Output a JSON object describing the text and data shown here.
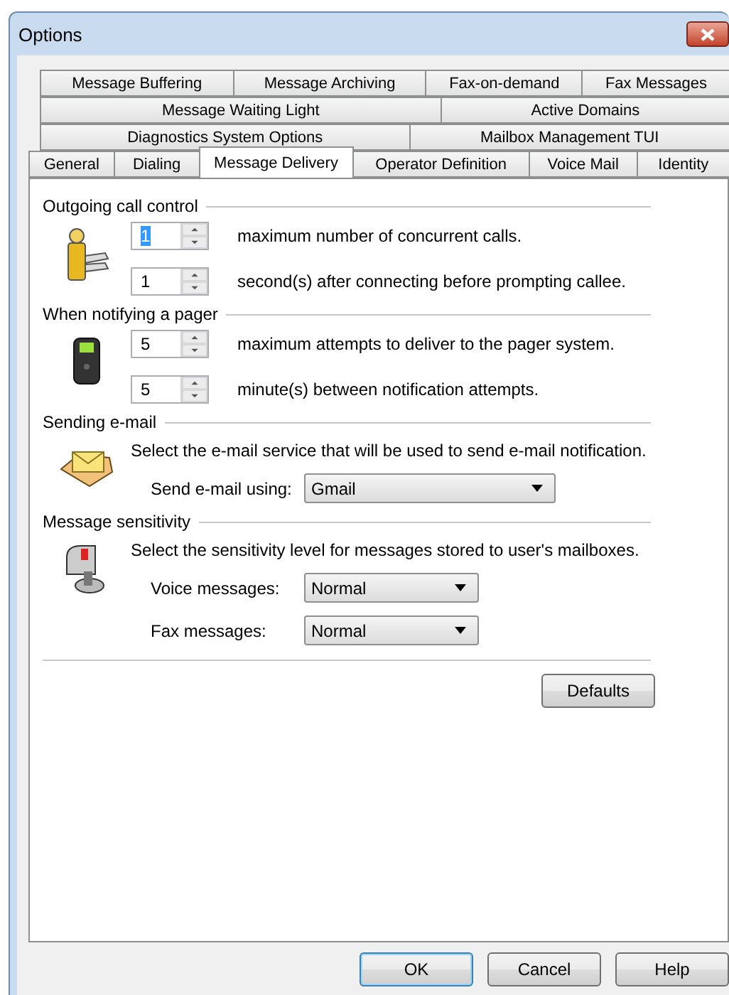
{
  "window": {
    "title": "Options"
  },
  "tab_rows": [
    [
      {
        "label": "Message Buffering",
        "selected": false
      },
      {
        "label": "Message Archiving",
        "selected": false
      },
      {
        "label": "Fax-on-demand",
        "selected": false
      },
      {
        "label": "Fax Messages",
        "selected": false
      }
    ],
    [
      {
        "label": "Message Waiting Light",
        "selected": false
      },
      {
        "label": "Active Domains",
        "selected": false
      }
    ],
    [
      {
        "label": "Diagnostics System Options",
        "selected": false
      },
      {
        "label": "Mailbox Management TUI",
        "selected": false
      }
    ],
    [
      {
        "label": "General",
        "selected": false
      },
      {
        "label": "Dialing",
        "selected": false
      },
      {
        "label": "Message Delivery",
        "selected": true
      },
      {
        "label": "Operator Definition",
        "selected": false
      },
      {
        "label": "Voice Mail",
        "selected": false
      },
      {
        "label": "Identity",
        "selected": false
      }
    ]
  ],
  "sections": [
    {
      "kind": "spinners",
      "title": "Outgoing call control",
      "rows": [
        {
          "value": "1",
          "highlighted": true,
          "label": "maximum number of concurrent calls."
        },
        {
          "value": "1",
          "highlighted": false,
          "label": "second(s) after connecting before prompting callee."
        }
      ]
    },
    {
      "kind": "spinners",
      "title": "When notifying a pager",
      "rows": [
        {
          "value": "5",
          "highlighted": false,
          "label": "maximum attempts to deliver to the pager system."
        },
        {
          "value": "5",
          "highlighted": false,
          "label": "minute(s) between notification attempts."
        }
      ]
    },
    {
      "kind": "selects",
      "title": "Sending e-mail",
      "description": "Select the e-mail service that will be used to send e-mail notification.",
      "rows": [
        {
          "label": "Send e-mail using:",
          "value": "Gmail"
        }
      ]
    },
    {
      "kind": "selects",
      "title": "Message sensitivity",
      "description": "Select the sensitivity level for messages stored to user's mailboxes.",
      "rows": [
        {
          "label": "Voice messages:",
          "value": "Normal"
        },
        {
          "label": "Fax messages:",
          "value": "Normal"
        }
      ]
    }
  ],
  "defaults_button": "Defaults",
  "buttons": [
    {
      "label": "OK",
      "default": true
    },
    {
      "label": "Cancel",
      "default": false
    },
    {
      "label": "Help",
      "default": false
    }
  ]
}
